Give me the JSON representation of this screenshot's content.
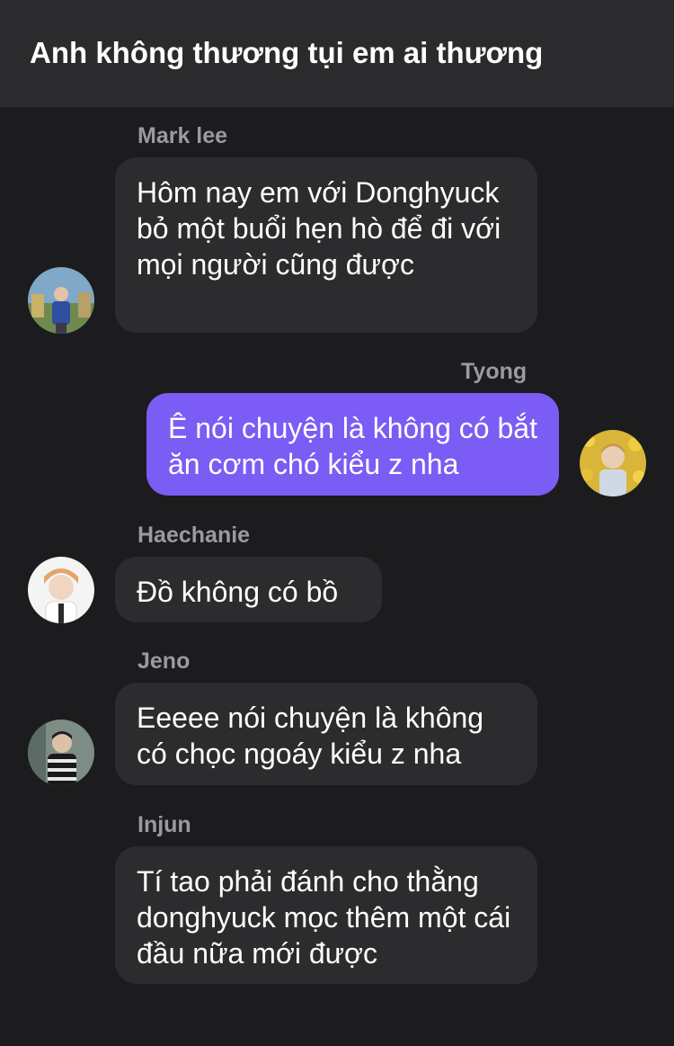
{
  "header": {
    "title": "Anh không thương tụi em ai thương"
  },
  "messages": [
    {
      "sender": "Mark lee",
      "text": "Hôm nay em với Donghyuck bỏ một buổi hẹn hò để đi với mọi người cũng được",
      "avatar_icon": "avatar-mark-lee-icon"
    },
    {
      "sender": "Tyong",
      "text": "Ê nói chuyện là không có bắt ăn cơm chó kiểu z nha",
      "avatar_icon": "avatar-tyong-icon"
    },
    {
      "sender": "Haechanie",
      "text": "Đồ không có bồ",
      "avatar_icon": "avatar-haechanie-icon"
    },
    {
      "sender": "Jeno",
      "text": "Eeeee nói chuyện là không có chọc ngoáy kiểu z nha",
      "avatar_icon": "avatar-jeno-icon"
    },
    {
      "sender": "Injun",
      "text": "Tí tao phải đánh cho thằng donghyuck mọc thêm một cái đầu nữa mới được"
    }
  ],
  "colors": {
    "background": "#1c1c1e",
    "header": "#2b2b2d",
    "incoming_bubble": "#2c2c2e",
    "outgoing_bubble": "#7b5cf5",
    "sender_name": "#9a9aa0"
  }
}
